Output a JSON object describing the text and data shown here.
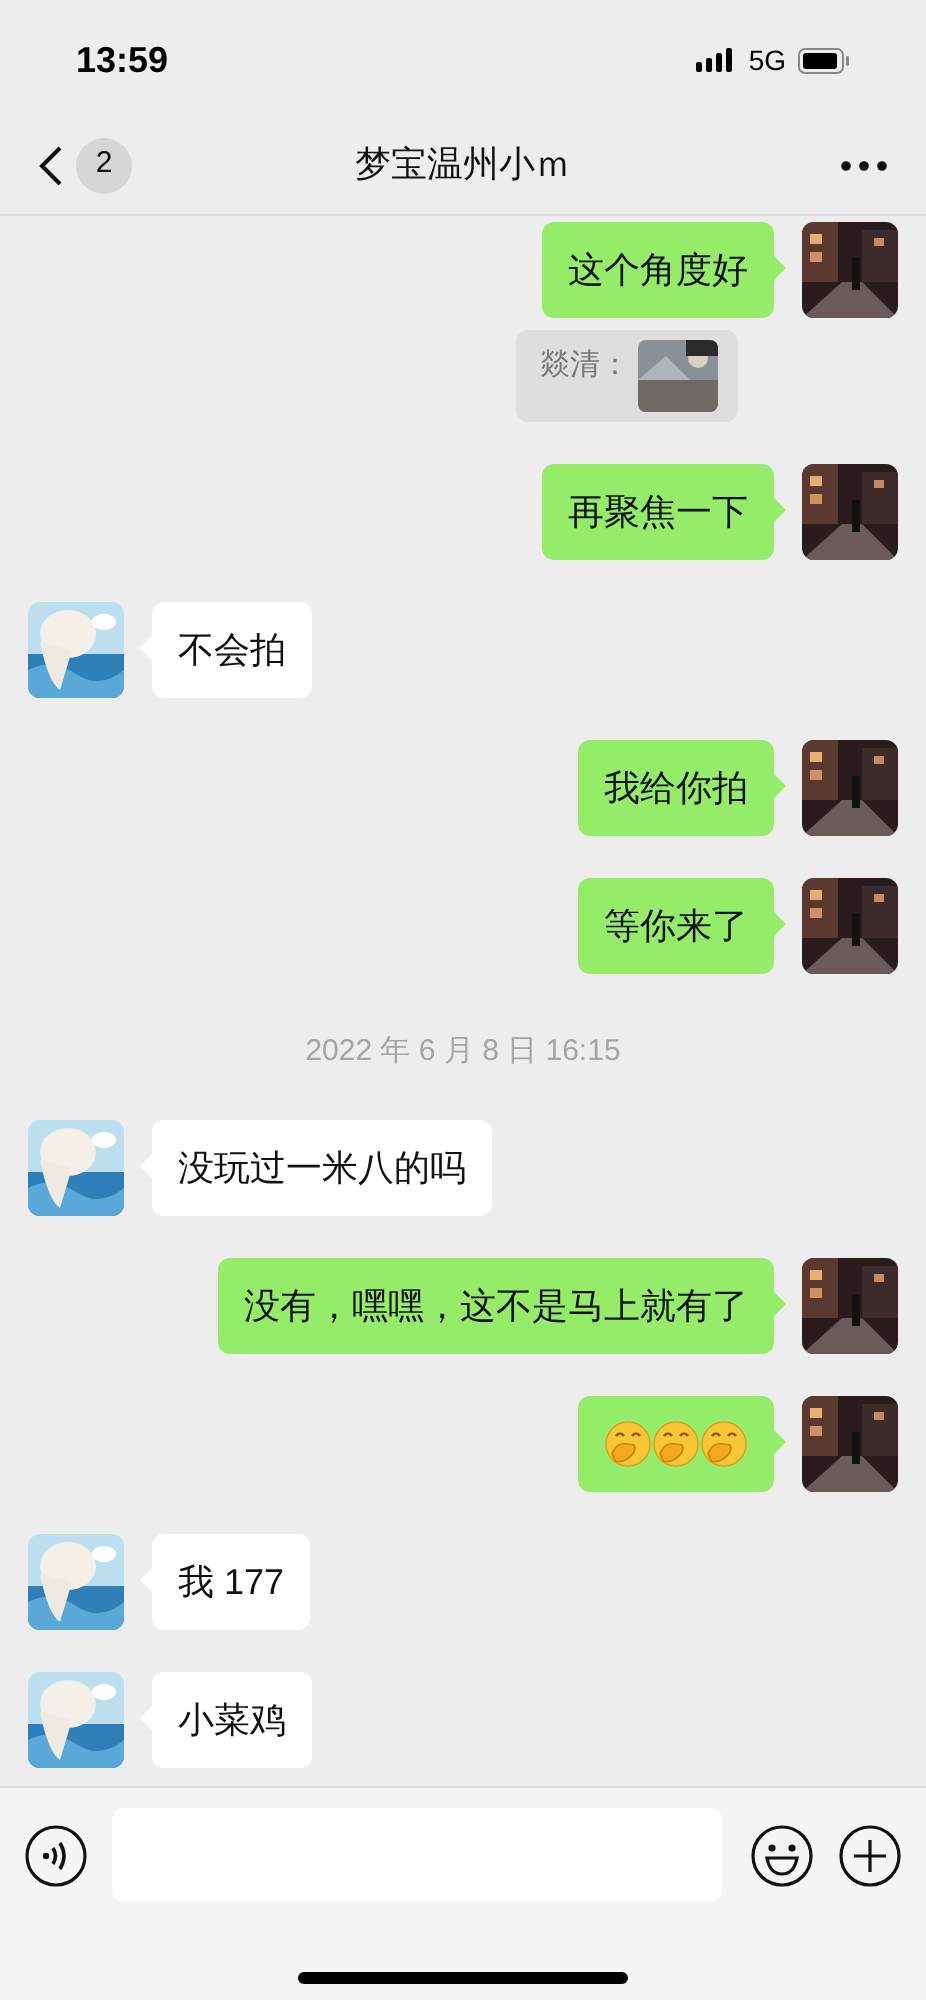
{
  "status_bar": {
    "time": "13:59",
    "network": "5G"
  },
  "nav": {
    "unread": "2",
    "title": "梦宝温州小ｍ"
  },
  "messages": [
    {
      "kind": "text",
      "outgoing": true,
      "text": "这个角度好"
    },
    {
      "kind": "quote",
      "text": "燚清："
    },
    {
      "kind": "text",
      "outgoing": true,
      "text": "再聚焦一下"
    },
    {
      "kind": "text",
      "outgoing": false,
      "text": "不会拍"
    },
    {
      "kind": "text",
      "outgoing": true,
      "text": "我给你拍"
    },
    {
      "kind": "text",
      "outgoing": true,
      "text": "等你来了"
    },
    {
      "kind": "time",
      "text": "2022 年 6 月 8 日 16:15"
    },
    {
      "kind": "text",
      "outgoing": false,
      "text": "没玩过一米八的吗"
    },
    {
      "kind": "text",
      "outgoing": true,
      "text": "没有，嘿嘿，这不是马上就有了"
    },
    {
      "kind": "emoji",
      "outgoing": true,
      "emojis": [
        {
          "kind": "covering-mouth"
        },
        {
          "kind": "covering-mouth"
        },
        {
          "kind": "covering-mouth"
        }
      ]
    },
    {
      "kind": "text",
      "outgoing": false,
      "text": "我 177"
    },
    {
      "kind": "text",
      "outgoing": false,
      "text": "小菜鸡"
    }
  ]
}
